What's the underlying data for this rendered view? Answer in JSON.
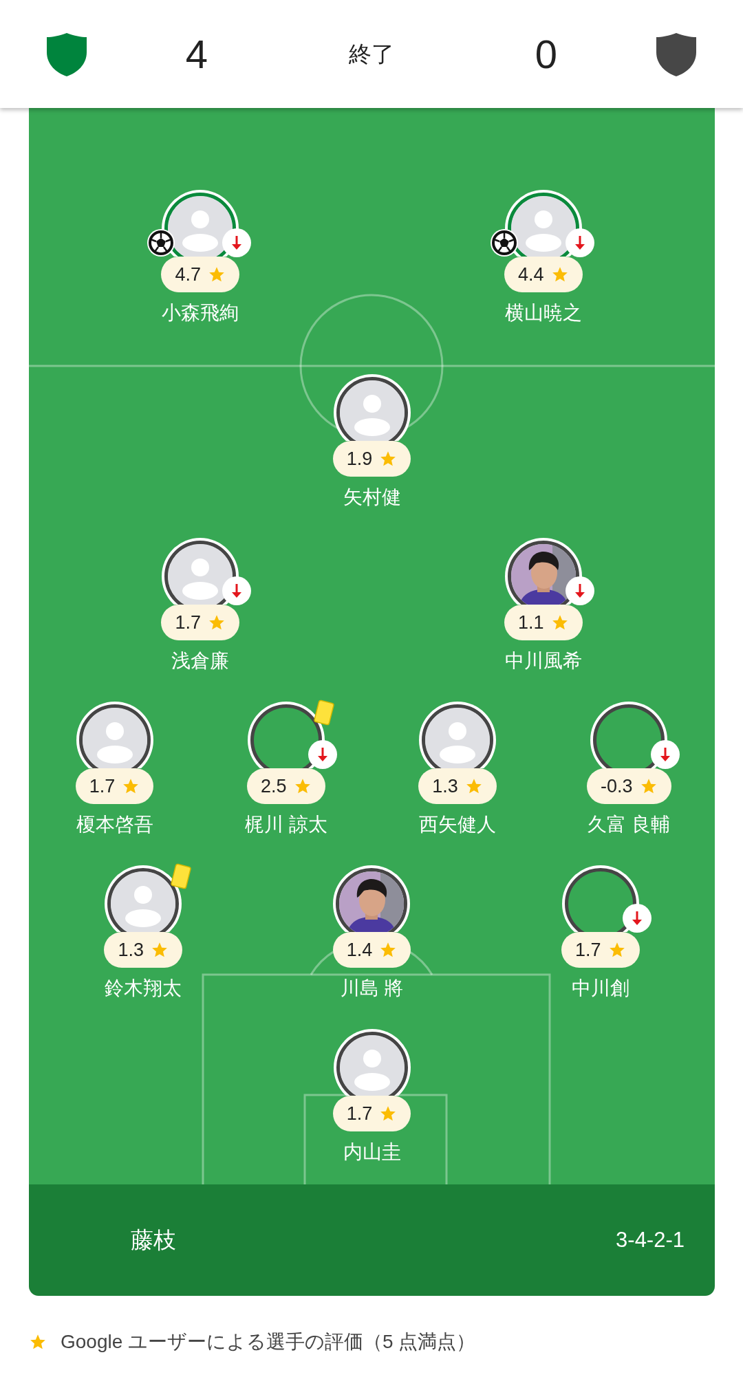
{
  "header": {
    "home_score": "4",
    "status": "終了",
    "away_score": "0"
  },
  "rows": [
    {
      "players": [
        {
          "name": "小森飛絢",
          "rating": "4.7",
          "kind": "placeholder",
          "goal": true,
          "subbed_off": true,
          "yellow_card": false
        },
        {
          "name": "横山暁之",
          "rating": "4.4",
          "kind": "placeholder",
          "goal": true,
          "subbed_off": true,
          "yellow_card": false
        }
      ]
    },
    {
      "players": [
        {
          "name": "矢村健",
          "rating": "1.9",
          "kind": "placeholder",
          "goal": false,
          "subbed_off": false,
          "yellow_card": false
        }
      ]
    },
    {
      "players": [
        {
          "name": "浅倉廉",
          "rating": "1.7",
          "kind": "placeholder",
          "goal": false,
          "subbed_off": true,
          "yellow_card": false
        },
        {
          "name": "中川風希",
          "rating": "1.1",
          "goal": false,
          "subbed_off": true,
          "yellow_card": false
        }
      ]
    },
    {
      "players": [
        {
          "name": "榎本啓吾",
          "rating": "1.7",
          "kind": "placeholder",
          "goal": false,
          "subbed_off": false,
          "yellow_card": false
        },
        {
          "name": "梶川 諒太",
          "rating": "2.5",
          "kind": "empty",
          "goal": false,
          "subbed_off": true,
          "yellow_card": true
        },
        {
          "name": "西矢健人",
          "rating": "1.3",
          "kind": "placeholder",
          "goal": false,
          "subbed_off": false,
          "yellow_card": false
        },
        {
          "name": "久富 良輔",
          "rating": "-0.3",
          "kind": "empty",
          "goal": false,
          "subbed_off": true,
          "yellow_card": false
        }
      ]
    },
    {
      "players": [
        {
          "name": "鈴木翔太",
          "rating": "1.3",
          "kind": "placeholder",
          "goal": false,
          "subbed_off": false,
          "yellow_card": true
        },
        {
          "name": "川島 將",
          "rating": "1.4",
          "goal": false,
          "subbed_off": false,
          "yellow_card": false
        },
        {
          "name": "中川創",
          "rating": "1.7",
          "kind": "empty",
          "goal": false,
          "subbed_off": true,
          "yellow_card": false
        }
      ]
    },
    {
      "players": [
        {
          "name": "内山圭",
          "rating": "1.7",
          "kind": "placeholder",
          "goal": false,
          "subbed_off": false,
          "yellow_card": false
        }
      ]
    }
  ],
  "footer": {
    "team": "藤枝",
    "formation": "3-4-2-1"
  },
  "legend": {
    "text": "Google ユーザーによる選手の評価（5 点満点）"
  }
}
